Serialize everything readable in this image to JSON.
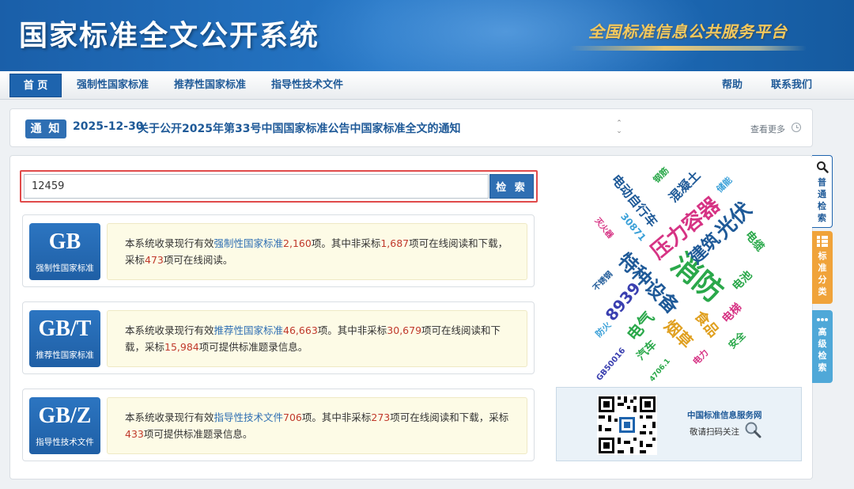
{
  "banner": {
    "site_title": "国家标准全文公开系统",
    "platform_name": "全国标准信息公共服务平台"
  },
  "nav": {
    "items": [
      "首 页",
      "强制性国家标准",
      "推荐性国家标准",
      "指导性技术文件"
    ],
    "right_items": [
      "帮助",
      "联系我们"
    ]
  },
  "notice": {
    "tag": "通 知",
    "date": "2025-12-30",
    "text": "关于公开2025年第33号中国国家标准公告中国家标准全文的通知",
    "more": "查看更多"
  },
  "search": {
    "value": "12459",
    "button": "检 索"
  },
  "standards": [
    {
      "code": "GB",
      "name": "强制性国家标准",
      "d1": "本系统收录现行有效",
      "link": "强制性国家标准",
      "total": "2,160",
      "d2": "项。其中非采标",
      "non_adopted": "1,687",
      "d3": "项可在线阅读和下载，采标",
      "adopted": "473",
      "d4": "项可在线阅读。"
    },
    {
      "code": "GB/T",
      "name": "推荐性国家标准",
      "d1": "本系统收录现行有效",
      "link": "推荐性国家标准",
      "total": "46,663",
      "d2": "项。其中非采标",
      "non_adopted": "30,679",
      "d3": "项可在线阅读和下载，采标",
      "adopted": "15,984",
      "d4": "项可提供标准题录信息。"
    },
    {
      "code": "GB/Z",
      "name": "指导性技术文件",
      "d1": "本系统收录现行有效",
      "link": "指导性技术文件",
      "total": "706",
      "d2": "项。其中非采标",
      "non_adopted": "273",
      "d3": "项可在线阅读和下载，采标",
      "adopted": "433",
      "d4": "项可提供标准题录信息。"
    }
  ],
  "word_cloud": [
    {
      "text": "消防",
      "color": "#2aa84a"
    },
    {
      "text": "压力容器",
      "color": "#d63384"
    },
    {
      "text": "特种设备",
      "color": "#1f5a98"
    },
    {
      "text": "光伏",
      "color": "#1f5a98"
    },
    {
      "text": "建筑",
      "color": "#1f5a98"
    },
    {
      "text": "8939",
      "color": "#3a3fb0"
    },
    {
      "text": "电气",
      "color": "#2aa84a"
    },
    {
      "text": "烟草",
      "color": "#e0a020"
    },
    {
      "text": "食品",
      "color": "#e0a020"
    },
    {
      "text": "电动自行车",
      "color": "#1f5a98"
    },
    {
      "text": "混凝土",
      "color": "#1f5a98"
    },
    {
      "text": "30871",
      "color": "#3aa0d8"
    },
    {
      "text": "电池",
      "color": "#2aa84a"
    },
    {
      "text": "电梯",
      "color": "#d63384"
    },
    {
      "text": "电缆",
      "color": "#2aa84a"
    },
    {
      "text": "钢筋",
      "color": "#2aa84a"
    },
    {
      "text": "储能",
      "color": "#3aa0d8"
    },
    {
      "text": "灭火器",
      "color": "#d63384"
    },
    {
      "text": "不锈钢",
      "color": "#1f5a98"
    },
    {
      "text": "汽车",
      "color": "#2aa84a"
    },
    {
      "text": "防火",
      "color": "#3aa0d8"
    },
    {
      "text": "GB50016",
      "color": "#3a3fb0"
    },
    {
      "text": "安全",
      "color": "#2aa84a"
    },
    {
      "text": "电力",
      "color": "#d63384"
    },
    {
      "text": "4706.1",
      "color": "#2aa84a"
    }
  ],
  "qr": {
    "label": "中国标准信息服务网",
    "sub": "敬请扫码关注"
  },
  "side_tabs": [
    "普通检索",
    "标准分类",
    "高级检索"
  ]
}
